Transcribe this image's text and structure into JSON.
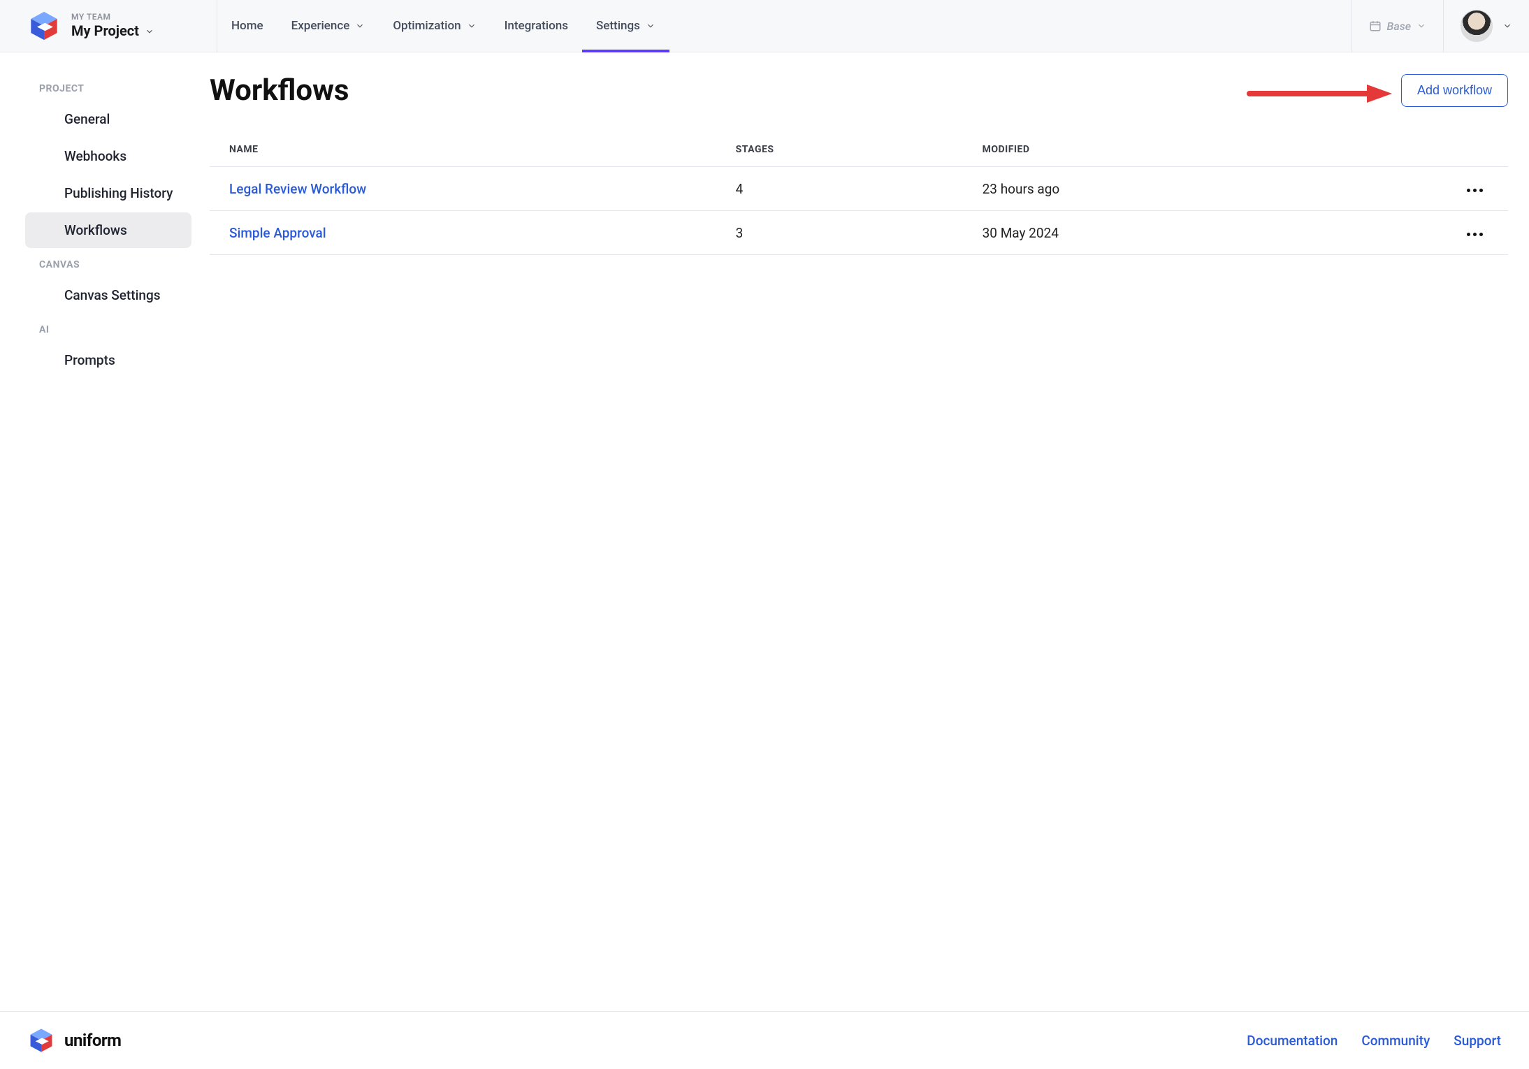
{
  "brand": {
    "team_label": "MY TEAM",
    "project_name": "My Project",
    "footer_name": "uniform"
  },
  "topnav": {
    "items": [
      {
        "label": "Home",
        "has_chevron": false,
        "active": false
      },
      {
        "label": "Experience",
        "has_chevron": true,
        "active": false
      },
      {
        "label": "Optimization",
        "has_chevron": true,
        "active": false
      },
      {
        "label": "Integrations",
        "has_chevron": false,
        "active": false
      },
      {
        "label": "Settings",
        "has_chevron": true,
        "active": true
      }
    ],
    "env_label": "Base"
  },
  "sidebar": {
    "sections": [
      {
        "title": "PROJECT",
        "items": [
          {
            "label": "General",
            "active": false
          },
          {
            "label": "Webhooks",
            "active": false
          },
          {
            "label": "Publishing History",
            "active": false
          },
          {
            "label": "Workflows",
            "active": true
          }
        ]
      },
      {
        "title": "CANVAS",
        "items": [
          {
            "label": "Canvas Settings",
            "active": false
          }
        ]
      },
      {
        "title": "AI",
        "items": [
          {
            "label": "Prompts",
            "active": false
          }
        ]
      }
    ]
  },
  "page": {
    "title": "Workflows",
    "add_button": "Add workflow"
  },
  "table": {
    "columns": {
      "name": "NAME",
      "stages": "STAGES",
      "modified": "MODIFIED"
    },
    "rows": [
      {
        "name": "Legal Review Workflow",
        "stages": "4",
        "modified": "23 hours ago"
      },
      {
        "name": "Simple Approval",
        "stages": "3",
        "modified": "30 May 2024"
      }
    ]
  },
  "footer": {
    "links": [
      {
        "label": "Documentation"
      },
      {
        "label": "Community"
      },
      {
        "label": "Support"
      }
    ]
  }
}
